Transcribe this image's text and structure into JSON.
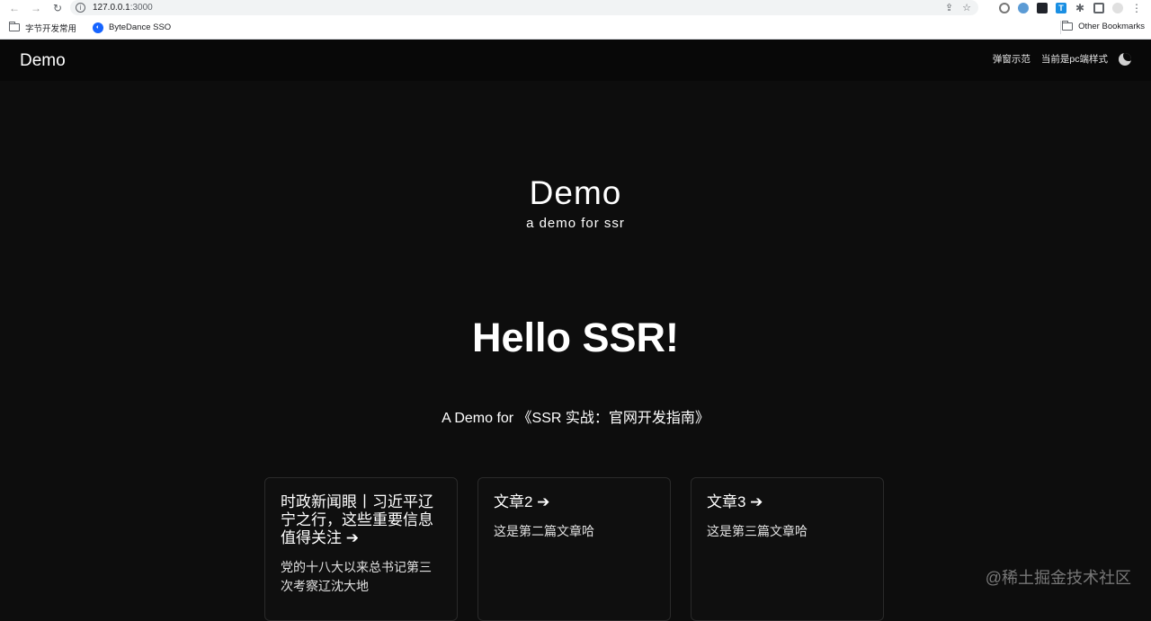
{
  "browser": {
    "url_host": "127.0.0.1",
    "url_port": ":3000",
    "bookmarks": [
      {
        "label": "字节开发常用",
        "icon": "folder-icon"
      },
      {
        "label": "ByteDance SSO",
        "icon": "sso-icon"
      }
    ],
    "other_bookmarks": "Other Bookmarks"
  },
  "header": {
    "logo": "Demo",
    "links": [
      "弹窗示范",
      "当前是pc端样式"
    ],
    "theme_icon": "moon-icon"
  },
  "hero": {
    "title": "Demo",
    "subtitle": "a demo for ssr",
    "heading": "Hello SSR!",
    "tagline": "A Demo for 《SSR 实战：官网开发指南》"
  },
  "cards": [
    {
      "title": "时政新闻眼丨习近平辽宁之行，这些重要信息值得关注 ➔",
      "desc": "党的十八大以来总书记第三次考察辽沈大地"
    },
    {
      "title": "文章2 ➔",
      "desc": "这是第二篇文章哈"
    },
    {
      "title": "文章3 ➔",
      "desc": "这是第三篇文章哈"
    }
  ],
  "watermark": "@稀土掘金技术社区",
  "colors": {
    "background": "#0d0d0d",
    "header": "#080808",
    "text": "#ffffff"
  }
}
